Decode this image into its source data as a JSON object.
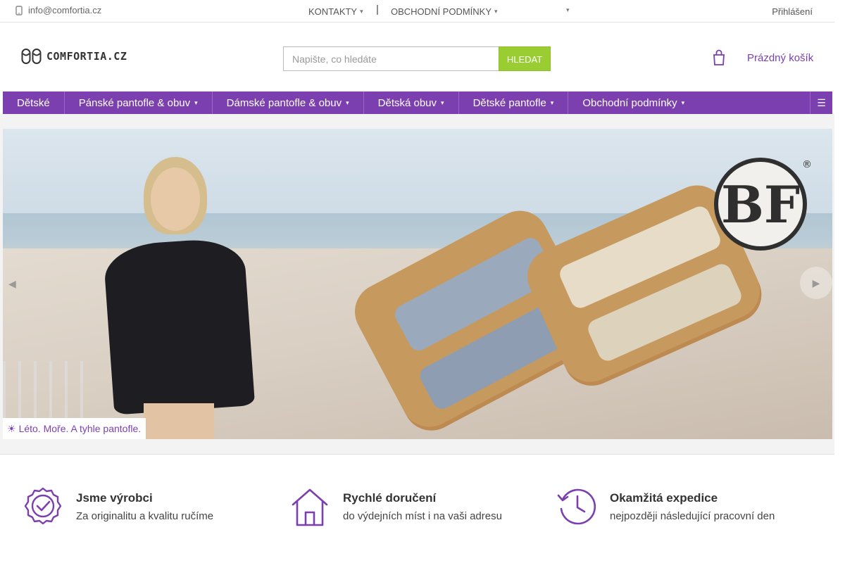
{
  "topbar": {
    "email": "info@comfortia.cz",
    "links": [
      {
        "label": "KONTAKTY",
        "icon": "chevron-down-icon"
      },
      {
        "label": "OBCHODNÍ PODMÍNKY",
        "icon": "chevron-down-icon"
      }
    ],
    "separator": "|",
    "extra_icon": "chevron-down-icon",
    "login": "Přihlášení"
  },
  "logo": {
    "text": "COMFORTIA.CZ"
  },
  "search": {
    "placeholder": "Napište, co hledáte",
    "button": "HLEDAT"
  },
  "cart": {
    "label": "Prázdný košík",
    "icon": "cart-icon"
  },
  "nav": {
    "items": [
      {
        "label": "Dětské",
        "has_submenu": false
      },
      {
        "label": "Pánské pantofle & obuv",
        "has_submenu": true
      },
      {
        "label": "Dámské pantofle & obuv",
        "has_submenu": true
      },
      {
        "label": "Dětská obuv",
        "has_submenu": true
      },
      {
        "label": "Dětské pantofle",
        "has_submenu": true
      },
      {
        "label": "Obchodní podmínky",
        "has_submenu": true
      }
    ],
    "menu_icon": "hamburger-icon"
  },
  "banner": {
    "caption_icon": "sun-icon",
    "caption": "Léto. Moře. A tyhle pantofle.",
    "brand_logo_text": "BF"
  },
  "features": [
    {
      "icon": "badge-check-icon",
      "title": "Jsme výrobci",
      "subtitle": "Za originalitu a kvalitu ručíme"
    },
    {
      "icon": "home-icon",
      "title": "Rychlé doručení",
      "subtitle": "do výdejních míst i na vaši adresu"
    },
    {
      "icon": "history-clock-icon",
      "title": "Okamžitá expedice",
      "subtitle": "nejpozději následující pracovní den"
    }
  ],
  "colors": {
    "accent": "#7b3fb0",
    "search_button": "#9acd32",
    "icon_purple": "#7b3fb0"
  }
}
